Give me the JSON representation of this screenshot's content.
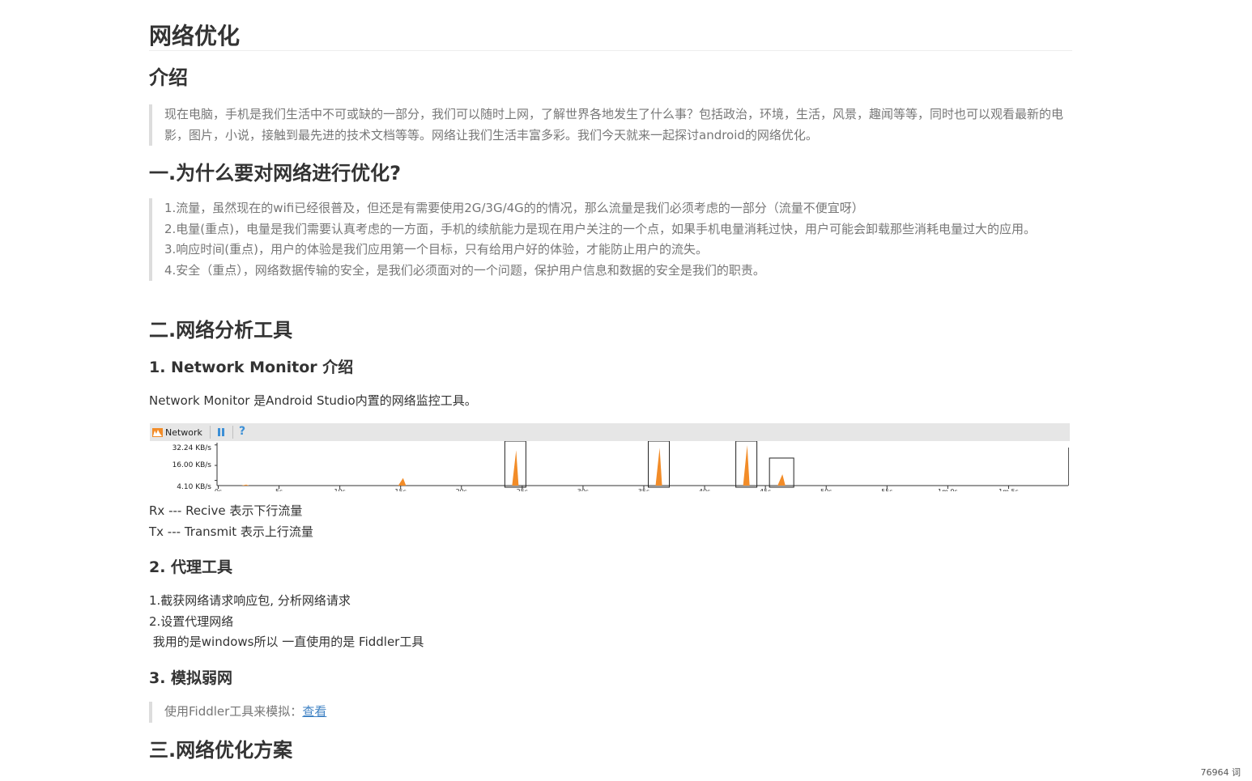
{
  "doc": {
    "title": "网络优化",
    "intro": {
      "heading": "介绍",
      "quote": "现在电脑，手机是我们生活中不可或缺的一部分，我们可以随时上网，了解世界各地发生了什么事？包括政治，环境，生活，风景，趣闻等等，同时也可以观看最新的电影，图片，小说，接触到最先进的技术文档等等。网络让我们生活丰富多彩。我们今天就来一起探讨android的网络优化。"
    },
    "section1": {
      "heading": "一.为什么要对网络进行优化?",
      "items": [
        "1.流量，虽然现在的wifi已经很普及，但还是有需要使用2G/3G/4G的的情况，那么流量是我们必须考虑的一部分（流量不便宜呀）",
        "2.电量(重点)，电量是我们需要认真考虑的一方面，手机的续航能力是现在用户关注的一个点，如果手机电量消耗过快，用户可能会卸载那些消耗电量过大的应用。",
        "3.响应时间(重点)，用户的体验是我们应用第一个目标，只有给用户好的体验，才能防止用户的流失。",
        "4.安全（重点），网络数据传输的安全，是我们必须面对的一个问题，保护用户信息和数据的安全是我们的职责。"
      ]
    },
    "section2": {
      "heading": "二.网络分析工具",
      "sub1": {
        "heading": "1. Network Monitor 介绍",
        "text": "Network Monitor 是Android Studio内置的网络监控工具。",
        "rx": "Rx --- Recive 表示下行流量",
        "tx": "Tx --- Transmit 表示上行流量"
      },
      "sub2": {
        "heading": "2. 代理工具",
        "lines": [
          "1.截获网络请求响应包, 分析网络请求",
          "2.设置代理网络",
          " 我用的是windows所以 一直使用的是 Fiddler工具"
        ]
      },
      "sub3": {
        "heading": "3. 模拟弱网",
        "quote_prefix": "使用Fiddler工具来模拟：",
        "link": "查看"
      }
    },
    "section3": {
      "heading": "三.网络优化方案"
    }
  },
  "monitor": {
    "label": "Network",
    "help": "?",
    "icon": "network-monitor-icon",
    "ylabels": [
      "32.24 KB/s",
      "16.00 KB/s",
      "4.10 KB/s"
    ],
    "xticks": [
      "0s",
      "5s",
      "10s",
      "15s",
      "20s",
      "25s",
      "30s",
      "35s",
      "40s",
      "45s",
      "50s",
      "55s",
      "1m 0s",
      "1m 5s"
    ],
    "accent": "#f28c28"
  },
  "chart_data": {
    "type": "area",
    "title": "Network",
    "xlabel": "",
    "ylabel": "",
    "x_unit": "s",
    "y_unit": "KB/s",
    "ylim": [
      0,
      34
    ],
    "xlim": [
      0,
      70
    ],
    "yticks": [
      4.1,
      16.0,
      32.24
    ],
    "series": [
      {
        "values": [
          {
            "x": 2.4,
            "y": 0.8
          },
          {
            "x": 15.3,
            "y": 6
          },
          {
            "x": 24.6,
            "y": 28
          },
          {
            "x": 36.4,
            "y": 30
          },
          {
            "x": 43.6,
            "y": 32
          },
          {
            "x": 46.5,
            "y": 9
          }
        ]
      }
    ],
    "highlight_boxes_at": [
      24.6,
      36.4,
      43.6,
      46.5
    ],
    "grid": false,
    "legend": "none"
  },
  "footer": {
    "wordcount": "76964 词"
  }
}
